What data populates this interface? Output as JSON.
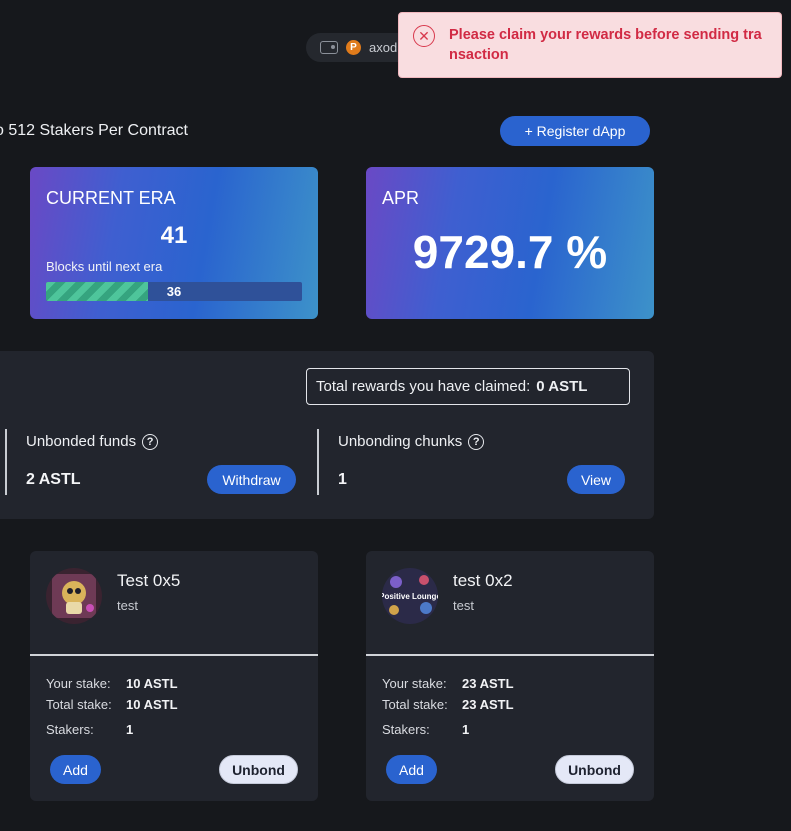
{
  "header": {
    "wallet_name": "axod",
    "coin_glyph": "P"
  },
  "toast": {
    "message": "Please claim your rewards before sending transaction",
    "color": "#d12a44"
  },
  "page": {
    "headline": "o 512 Stakers Per Contract",
    "register_label": "+ Register dApp"
  },
  "era": {
    "title": "CURRENT ERA",
    "number": "41",
    "subtitle": "Blocks until next era",
    "blocks_remaining": "36",
    "progress_fraction": 0.4
  },
  "apr": {
    "title": "APR",
    "value": "9729.7 %"
  },
  "rewards": {
    "claimed_label": "Total rewards you have claimed:",
    "claimed_value": "0 ASTL"
  },
  "unbonded": {
    "label": "Unbonded funds",
    "value": "2 ASTL",
    "button": "Withdraw"
  },
  "unbonding": {
    "label": "Unbonding chunks",
    "value": "1",
    "button": "View"
  },
  "dapps": [
    {
      "name": "Test 0x5",
      "description": "test",
      "your_stake_label": "Your stake:",
      "your_stake": "10 ASTL",
      "total_stake_label": "Total stake:",
      "total_stake": "10 ASTL",
      "stakers_label": "Stakers:",
      "stakers": "1",
      "add_label": "Add",
      "unbond_label": "Unbond"
    },
    {
      "name": "test 0x2",
      "description": "test",
      "logo_text": "Positive Lounge",
      "your_stake_label": "Your stake:",
      "your_stake": "23 ASTL",
      "total_stake_label": "Total stake:",
      "total_stake": "23 ASTL",
      "stakers_label": "Stakers:",
      "stakers": "1",
      "add_label": "Add",
      "unbond_label": "Unbond"
    }
  ],
  "colors": {
    "primary": "#2a63cf",
    "background": "#16181c",
    "card": "#22252d"
  }
}
